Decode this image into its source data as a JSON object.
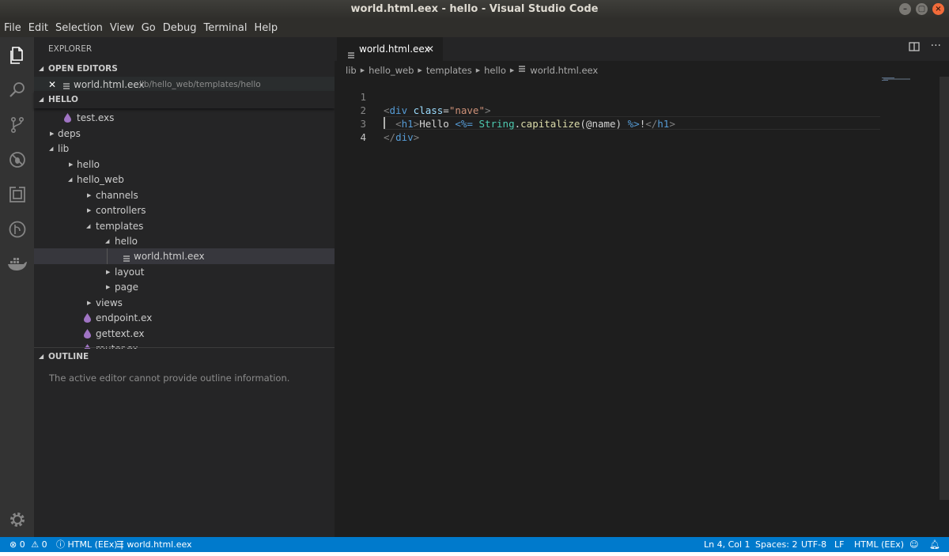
{
  "window": {
    "title": "world.html.eex - hello - Visual Studio Code"
  },
  "menu": [
    "File",
    "Edit",
    "Selection",
    "View",
    "Go",
    "Debug",
    "Terminal",
    "Help"
  ],
  "activity_bar": {
    "icons": [
      "explorer-icon",
      "search-icon",
      "source-control-icon",
      "debug-icon",
      "extensions-icon",
      "git-history-icon",
      "docker-icon"
    ],
    "bottom_icon": "settings-gear-icon"
  },
  "sidebar": {
    "title": "EXPLORER",
    "open_editors": {
      "label": "OPEN EDITORS",
      "items": [
        {
          "name": "world.html.eex",
          "path": "lib/hello_web/templates/hello"
        }
      ]
    },
    "workspace": {
      "label": "HELLO",
      "tree": [
        {
          "name": "test.exs",
          "type": "elixir"
        },
        {
          "name": "deps",
          "type": "folder-closed"
        },
        {
          "name": "lib",
          "type": "folder-open"
        },
        {
          "name": "hello",
          "type": "folder-closed"
        },
        {
          "name": "hello_web",
          "type": "folder-open"
        },
        {
          "name": "channels",
          "type": "folder-closed"
        },
        {
          "name": "controllers",
          "type": "folder-closed"
        },
        {
          "name": "templates",
          "type": "folder-open"
        },
        {
          "name": "hello",
          "type": "folder-open"
        },
        {
          "name": "world.html.eex",
          "type": "file"
        },
        {
          "name": "layout",
          "type": "folder-closed"
        },
        {
          "name": "page",
          "type": "folder-closed"
        },
        {
          "name": "views",
          "type": "folder-closed"
        },
        {
          "name": "endpoint.ex",
          "type": "elixir"
        },
        {
          "name": "gettext.ex",
          "type": "elixir"
        },
        {
          "name": "router.ex",
          "type": "elixir"
        }
      ]
    },
    "outline": {
      "label": "OUTLINE",
      "message": "The active editor cannot provide outline information."
    }
  },
  "editor": {
    "tab": {
      "name": "world.html.eex",
      "close": "✕"
    },
    "breadcrumb": [
      "lib",
      "hello_web",
      "templates",
      "hello",
      "world.html.eex"
    ],
    "line_numbers": [
      "1",
      "2",
      "3",
      "4"
    ],
    "code": {
      "l1": {
        "open": "<",
        "tag": "div",
        "attr": "class",
        "eq": "=",
        "val": "\"nave\"",
        "close": ">"
      },
      "l2": {
        "open": "<",
        "tag": "h1",
        "close": ">",
        "text": "Hello ",
        "eex_open": "<%=",
        "cls": "String",
        "dot": ".",
        "fn": "capitalize",
        "args": "(@name) ",
        "eex_close": "%>",
        "bang": "!",
        "end_open": "</",
        "end_tag": "h1",
        "end_close": ">"
      },
      "l3": {
        "open": "</",
        "tag": "div",
        "close": ">"
      }
    }
  },
  "statusbar": {
    "errors": "0",
    "warnings": "0",
    "language_info": "HTML (EEx)",
    "file": "world.html.eex",
    "position": "Ln 4, Col 1",
    "spaces": "Spaces: 2",
    "encoding": "UTF-8",
    "eol": "LF",
    "language": "HTML (EEx)"
  },
  "colors": {
    "accent": "#007acc",
    "sidebar_bg": "#252526",
    "editor_bg": "#1e1e1e",
    "activity_bg": "#333333",
    "elixir_purple": "#a074c4"
  }
}
